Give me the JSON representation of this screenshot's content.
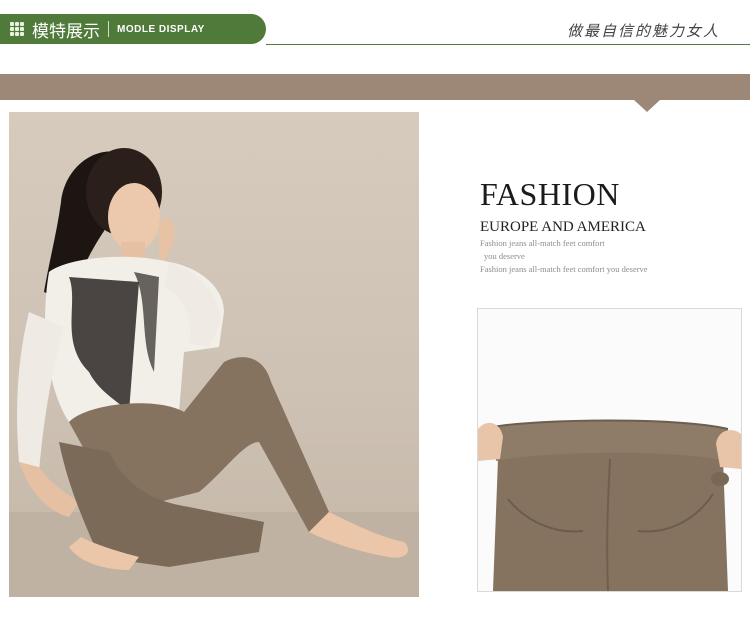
{
  "header": {
    "tab_cn": "模特展示",
    "tab_en": "MODLE DISPLAY",
    "slogan": "做最自信的魅力女人"
  },
  "text_block": {
    "title": "FASHION",
    "subtitle": "EUROPE AND AMERICA",
    "lines": [
      "Fashion jeans all-match feet comfort",
      "you deserve",
      "Fashion jeans all-match feet comfort you deserve"
    ]
  },
  "colors": {
    "tab_green": "#4f7a3a",
    "band_brown": "#9d8877",
    "pants_khaki": "#857360"
  }
}
